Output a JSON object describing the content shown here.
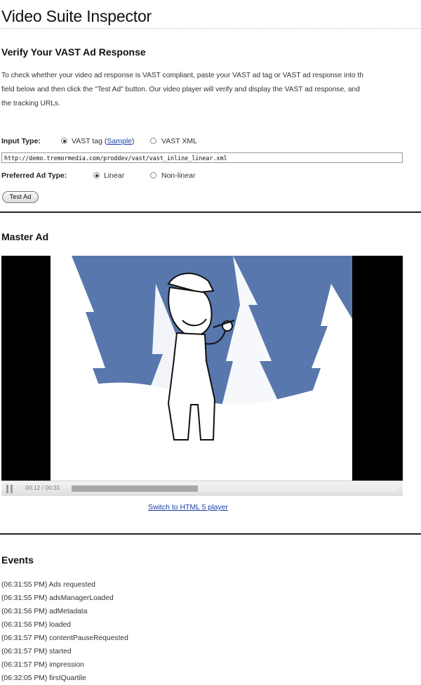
{
  "page": {
    "title": "Video Suite Inspector"
  },
  "verify": {
    "heading": "Verify Your VAST Ad Response",
    "intro_lines": [
      "To check whether your video ad response is VAST compliant, paste your VAST ad tag or VAST ad response into th",
      "field below and then click the \"Test Ad\" button. Our video player will verify and display the VAST ad response, and",
      "the tracking URLs."
    ]
  },
  "form": {
    "input_type_label": "Input Type:",
    "vast_tag_label": "VAST tag (",
    "sample_link": "Sample",
    "vast_tag_close": ")",
    "vast_xml_label": "VAST XML",
    "url_value": "http://demo.tremormedia.com/proddev/vast/vast_inline_linear.xml",
    "preferred_label": "Preferred Ad Type:",
    "linear_label": "Linear",
    "nonlinear_label": "Non-linear",
    "test_button": "Test Ad"
  },
  "master": {
    "heading": "Master Ad",
    "time": "00:12 / 00:31",
    "progress": 0.39,
    "switch_link": "Switch to HTML 5 player"
  },
  "events": {
    "heading": "Events",
    "items": [
      "(06:31:55 PM) Ads requested",
      "(06:31:55 PM) adsManagerLoaded",
      "(06:31:56 PM) adMetadata",
      "(06:31:56 PM) loaded",
      "(06:31:57 PM) contentPauseRequested",
      "(06:31:57 PM) started",
      "(06:31:57 PM) impression",
      "(06:32:05 PM) firstQuartile"
    ]
  }
}
